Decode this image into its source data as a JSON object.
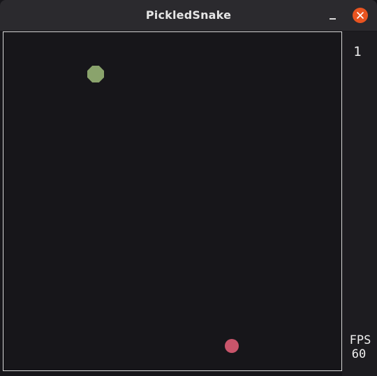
{
  "window": {
    "title": "PickledSnake"
  },
  "titlebar_buttons": {
    "minimize_icon": "minimize-icon",
    "close_icon": "close-icon"
  },
  "game": {
    "apple_color": "#8aa36c",
    "snake_color": "#c9556b",
    "board_border_color": "#d8d8d8",
    "background_color": "#17161a"
  },
  "hud": {
    "score": "1",
    "fps_label": "FPS",
    "fps_value": "60"
  }
}
